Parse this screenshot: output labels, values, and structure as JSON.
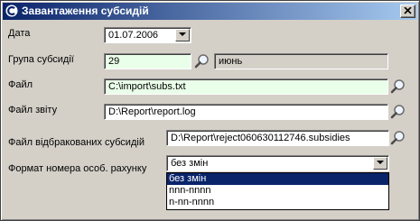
{
  "window": {
    "title": "Завантаження субсидій"
  },
  "form": {
    "date_label": "Дата",
    "date_value": "01.07.2006",
    "group_label": "Група субсидії",
    "group_value": "29",
    "group_name": "июнь",
    "file_label": "Файл",
    "file_value": "C:\\import\\subs.txt",
    "report_label": "Файл звіту",
    "report_value": "D:\\Report\\report.log",
    "reject_label": "Файл відбракованих субсидій",
    "reject_value": "D:\\Report\\reject060630112746.subsidies",
    "format_label": "Формат номера особ. рахунку",
    "format_value": "без змін",
    "format_options": [
      "без змін",
      "nnn-nnnn",
      "n-nn-nnnn"
    ]
  },
  "colors": {
    "title_start": "#0a246a",
    "title_end": "#a6caf0",
    "field_bg": "#eaffea",
    "selection": "#0a246a"
  },
  "icons": {
    "app": "app-logo-icon",
    "close": "close-icon",
    "search": "magnifier-icon",
    "dropdown": "chevron-down-icon"
  }
}
